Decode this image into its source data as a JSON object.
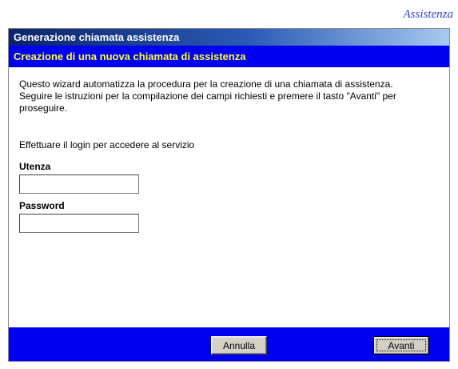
{
  "corner_link": "Assistenza",
  "dialog": {
    "title": "Generazione chiamata assistenza",
    "header": "Creazione di una nuova chiamata di assistenza",
    "intro_line1": "Questo wizard automatizza la procedura per la creazione di una chiamata di assistenza.",
    "intro_line2": "Seguire le istruzioni per la compilazione dei campi richiesti e premere il tasto \"Avanti\" per proseguire.",
    "login_prompt": "Effettuare il login per accedere al servizio",
    "username_label": "Utenza",
    "username_value": "",
    "password_label": "Password",
    "password_value": "",
    "cancel_label": "Annulla",
    "next_label": "Avanti"
  },
  "colors": {
    "header_bg": "#0000f0",
    "header_text": "#ffff33",
    "title_bg": "#0a246a",
    "link": "#2b3fd6"
  }
}
